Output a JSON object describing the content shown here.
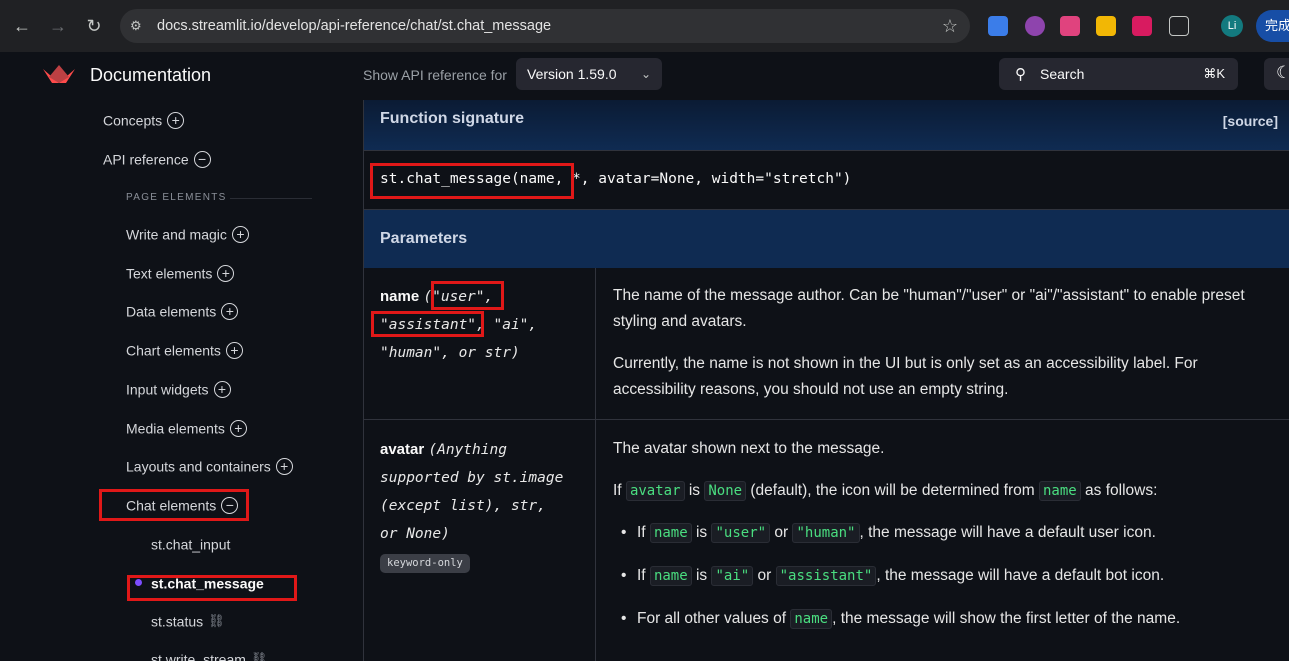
{
  "browser": {
    "url": "docs.streamlit.io/develop/api-reference/chat/st.chat_message",
    "profile_initials": "Li",
    "complete_label": "完成"
  },
  "header": {
    "title": "Documentation",
    "api_label": "Show API reference for",
    "version": "Version 1.59.0",
    "search_label": "Search",
    "search_shortcut": "⌘K"
  },
  "sidebar": {
    "concepts": "Concepts",
    "api_reference": "API reference",
    "section": "PAGE ELEMENTS",
    "items": [
      "Write and magic",
      "Text elements",
      "Data elements",
      "Chart elements",
      "Input widgets",
      "Media elements",
      "Layouts and containers",
      "Chat elements"
    ],
    "sub_items": [
      "st.chat_input",
      "st.chat_message",
      "st.status",
      "st.write_stream"
    ]
  },
  "main": {
    "signature_title": "Function signature",
    "source_label": "[source]",
    "signature_a": "st.chat_message(name,",
    "signature_b": " *, avatar=None, width=\"stretch\")",
    "params_title": "Parameters",
    "name_param": {
      "name": "name",
      "type_a": "(\"user\",",
      "type_b": "\"assistant\"",
      "type_c": ", \"ai\",",
      "type_d": "\"human\", or str)",
      "desc1": "The name of the message author. Can be \"human\"/\"user\" or \"ai\"/\"assistant\" to enable preset styling and avatars.",
      "desc2": "Currently, the name is not shown in the UI but is only set as an accessibility label. For accessibility reasons, you should not use an empty string."
    },
    "avatar_param": {
      "name": "avatar",
      "type_a": "(Anything",
      "type_b": "supported by st.image",
      "type_c": "(except list), str,",
      "type_d": "or None)",
      "badge": "keyword-only",
      "desc1": "The avatar shown next to the message.",
      "if_text": "If",
      "code_avatar": "avatar",
      "is_text": "is",
      "code_none": "None",
      "default_text": "(default), the icon will be determined from",
      "code_name": "name",
      "as_follows": "as follows:",
      "b1_if": "If",
      "b1_is": "is",
      "b1_code_user": "\"user\"",
      "b1_or": "or",
      "b1_code_human": "\"human\"",
      "b1_tail": ", the message will have a default user icon.",
      "b2_code_ai": "\"ai\"",
      "b2_code_assistant": "\"assistant\"",
      "b2_tail": ", the message will have a default bot icon.",
      "b3_head": "For all other values of",
      "b3_tail": ", the message will show the first letter of the name."
    }
  }
}
